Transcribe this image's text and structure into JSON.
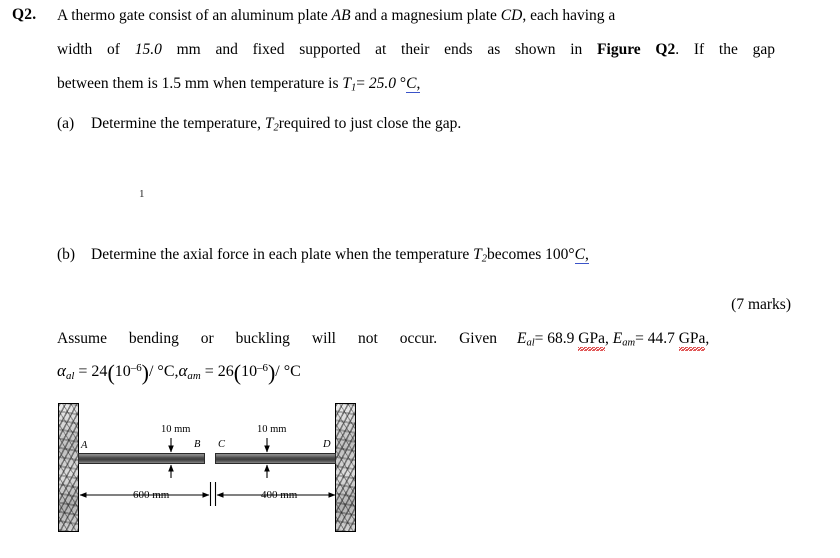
{
  "question": {
    "number": "Q2.",
    "line1_pre": "A thermo gate consist of an aluminum plate ",
    "line1_ab": "AB",
    "line1_mid": " and a magnesium plate ",
    "line1_cd": "CD",
    "line1_post": ", each having a",
    "line2_pre": "width of ",
    "line2_val": "15.0",
    "line2_mid": " mm and fixed supported at their ends as shown in ",
    "line2_fig": "Figure Q2",
    "line2_post": ". If the gap",
    "line3_pre": "between them is 1.5 mm when temperature is ",
    "line3_T": "T",
    "line3_sub": "1",
    "line3_eq": "= ",
    "line3_val": "25.0",
    "line3_deg": " °",
    "line3_unit": "C",
    "line3_tail": ","
  },
  "parts": {
    "a": {
      "label": "(a)",
      "text_pre": "Determine the temperature, ",
      "sym": "T",
      "sub": "2",
      "text_post": "required to just close the gap."
    },
    "b": {
      "label": "(b)",
      "text_pre": "Determine the axial force in each plate when the temperature ",
      "sym": "T",
      "sub": "2",
      "text_mid": "becomes 100°",
      "unit": "C",
      "tail": ","
    }
  },
  "stray_mark": "1",
  "marks": "(7 marks)",
  "assume": {
    "text": "Assume bending or buckling will not occur. Given"
  },
  "given": {
    "E_sym": "E",
    "E_al_sub": "al",
    "E_al_eq": "= 68.9 ",
    "E_al_unit": "GPa",
    "sep": ", ",
    "E_am_sub": "am",
    "E_am_eq": "= 44.7 ",
    "E_am_unit": "GPa",
    "tail": ","
  },
  "alphas": {
    "a_sym": "α",
    "al_sub": "al",
    "eq1": " = 24",
    "p_open": "(",
    "ten": "10",
    "exp": "–6",
    "p_close": ")",
    "per1": "/ °C,",
    "am_sub": "am",
    "eq2": " = 26",
    "per2": "/ °C"
  },
  "figure": {
    "label_A": "A",
    "label_B": "B",
    "label_C": "C",
    "label_D": "D",
    "thickness_left": "10 mm",
    "thickness_right": "10 mm",
    "span_left": "600 mm",
    "span_right": "400 mm"
  },
  "colors": {
    "plate_dark": "#3d3d3d",
    "wall_gray": "#9a9a9a",
    "spell_red": "#d62020",
    "grammar_blue": "#3a53c8",
    "ink": "#000000",
    "page": "#ffffff"
  }
}
